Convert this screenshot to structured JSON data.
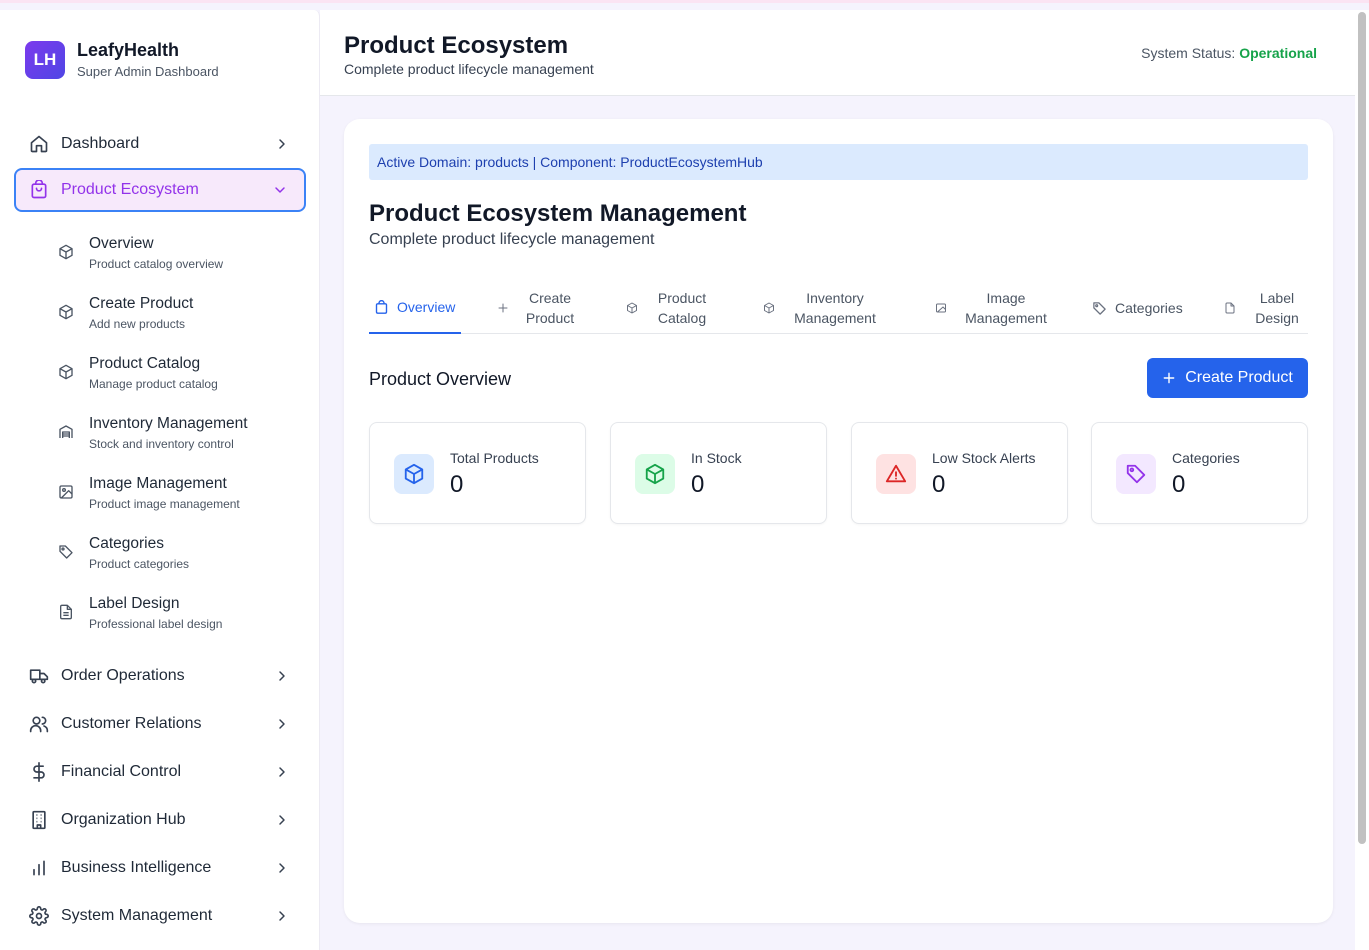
{
  "brand": {
    "logo": "LH",
    "name": "LeafyHealth",
    "subtitle": "Super Admin Dashboard"
  },
  "sidebar": {
    "items": [
      {
        "label": "Dashboard",
        "icon": "home-icon"
      },
      {
        "label": "Product Ecosystem",
        "icon": "shopping-bag-icon",
        "active": true
      },
      {
        "label": "Order Operations",
        "icon": "truck-icon"
      },
      {
        "label": "Customer Relations",
        "icon": "users-icon"
      },
      {
        "label": "Financial Control",
        "icon": "dollar-icon"
      },
      {
        "label": "Organization Hub",
        "icon": "building-icon"
      },
      {
        "label": "Business Intelligence",
        "icon": "bar-chart-icon"
      },
      {
        "label": "System Management",
        "icon": "gear-icon"
      }
    ],
    "sub_items": [
      {
        "title": "Overview",
        "desc": "Product catalog overview",
        "icon": "package-icon"
      },
      {
        "title": "Create Product",
        "desc": "Add new products",
        "icon": "package-icon"
      },
      {
        "title": "Product Catalog",
        "desc": "Manage product catalog",
        "icon": "package-icon"
      },
      {
        "title": "Inventory Management",
        "desc": "Stock and inventory control",
        "icon": "warehouse-icon"
      },
      {
        "title": "Image Management",
        "desc": "Product image management",
        "icon": "image-icon"
      },
      {
        "title": "Categories",
        "desc": "Product categories",
        "icon": "tag-icon"
      },
      {
        "title": "Label Design",
        "desc": "Professional label design",
        "icon": "file-icon"
      }
    ]
  },
  "header": {
    "title": "Product Ecosystem",
    "subtitle": "Complete product lifecycle management",
    "status_label": "System Status:",
    "status_value": "Operational",
    "status_color": "#16a34a"
  },
  "main": {
    "banner": "Active Domain: products | Component: ProductEcosystemHub",
    "title": "Product Ecosystem Management",
    "subtitle": "Complete product lifecycle management",
    "tabs": [
      {
        "label": "Overview",
        "icon": "shopping-bag-icon",
        "active": true
      },
      {
        "label": "Create Product",
        "icon": "plus-icon"
      },
      {
        "label": "Product Catalog",
        "icon": "package-icon"
      },
      {
        "label": "Inventory Management",
        "icon": "package-icon"
      },
      {
        "label": "Image Management",
        "icon": "image-icon"
      },
      {
        "label": "Categories",
        "icon": "tag-icon"
      },
      {
        "label": "Label Design",
        "icon": "file-icon"
      }
    ],
    "overview_title": "Product Overview",
    "create_button": "Create Product",
    "accent_color": "#2563eb",
    "stats": [
      {
        "label": "Total Products",
        "value": "0",
        "icon": "package-icon",
        "color": "#2563eb",
        "bg": "#dbeafe"
      },
      {
        "label": "In Stock",
        "value": "0",
        "icon": "package-icon",
        "color": "#16a34a",
        "bg": "#dcfce7"
      },
      {
        "label": "Low Stock Alerts",
        "value": "0",
        "icon": "alert-triangle-icon",
        "color": "#dc2626",
        "bg": "#fee2e2"
      },
      {
        "label": "Categories",
        "value": "0",
        "icon": "tag-icon",
        "color": "#9333ea",
        "bg": "#f3e8ff"
      }
    ]
  }
}
